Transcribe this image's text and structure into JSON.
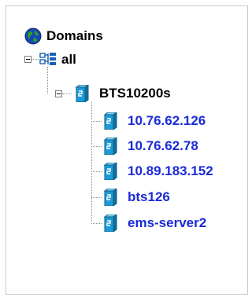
{
  "tree": {
    "root": {
      "label": "Domains",
      "icon": "globe-icon"
    },
    "group": {
      "label": "all",
      "icon": "network-tree-icon"
    },
    "platform": {
      "label": "BTS10200s",
      "icon": "server-node-icon"
    },
    "nodes": [
      {
        "label": "10.76.62.126",
        "icon": "server-node-icon"
      },
      {
        "label": "10.76.62.78",
        "icon": "server-node-icon"
      },
      {
        "label": "10.89.183.152",
        "icon": "server-node-icon"
      },
      {
        "label": "bts126",
        "icon": "server-node-icon"
      },
      {
        "label": "ems-server2",
        "icon": "server-node-icon"
      }
    ]
  },
  "colors": {
    "node_text": "#1a2bd6",
    "node_icon": "#1e9bd6",
    "globe": "#1747b0"
  }
}
